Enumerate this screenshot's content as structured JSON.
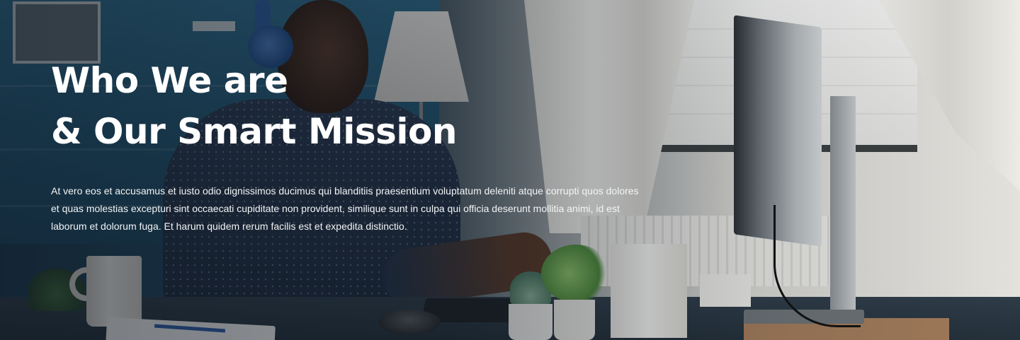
{
  "hero": {
    "title_line1": "Who We are",
    "title_line2": "& Our Smart Mission",
    "description": "At vero eos et accusamus et iusto odio dignissimos ducimus qui blanditiis praesentium voluptatum deleniti atque corrupti quos dolores et quas molestias excepturi sint occaecati cupiditate non provident, similique sunt in culpa qui officia deserunt mollitia animi, id est laborum et dolorum fuga. Et harum quidem rerum facilis est et expedita distinctio."
  }
}
